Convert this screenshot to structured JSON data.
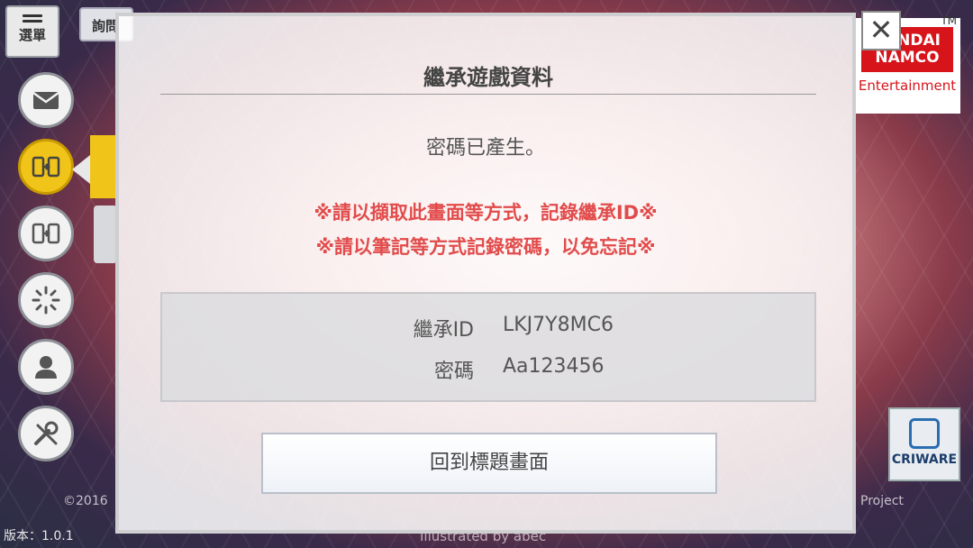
{
  "menu": {
    "label": "選單"
  },
  "top_tab": {
    "label": "詢問"
  },
  "sidebar": {
    "items": [
      {
        "icon": "mail-icon"
      },
      {
        "icon": "transfer-icon",
        "active": true
      },
      {
        "icon": "transfer-icon"
      },
      {
        "icon": "loading-icon"
      },
      {
        "icon": "profile-icon"
      },
      {
        "icon": "tools-icon"
      }
    ]
  },
  "brand": {
    "line1": "BANDAI",
    "line2": "NAMCO",
    "line3": "Entertainment",
    "tm": "TM"
  },
  "criware": {
    "label": "CRIWARE"
  },
  "footer": {
    "copyright_left": "©2016",
    "copyright_right": "Project",
    "version": "版本：1.0.1",
    "illustrated": "Illustrated by abec"
  },
  "dialog": {
    "title": "繼承遊戲資料",
    "message": "密碼已產生。",
    "warning1": "※請以擷取此畫面等方式，記錄繼承ID※",
    "warning2": "※請以筆記等方式記錄密碼，以免忘記※",
    "id_label": "繼承ID",
    "id_value": "LKJ7Y8MC6",
    "password_label": "密碼",
    "password_value": "Aa123456",
    "back_button": "回到標題畫面",
    "close": "✕"
  },
  "colors": {
    "warning": "#e24b4b",
    "active": "#f0c419",
    "brand": "#d7141a"
  }
}
